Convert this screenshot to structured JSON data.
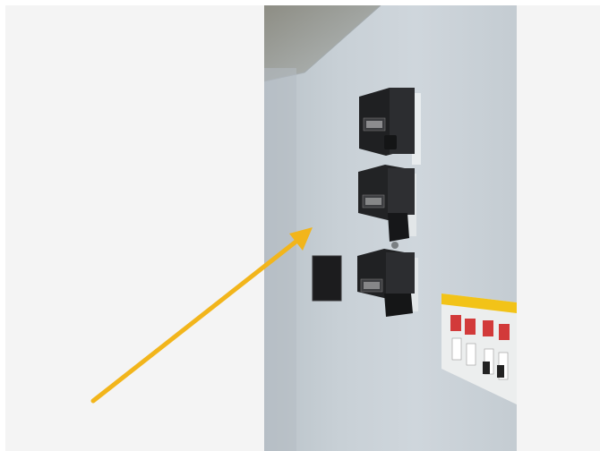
{
  "image": {
    "subject": "electrical-meters-on-wall",
    "colors": {
      "background": "#f4f4f4",
      "wall": "#cbd3d9",
      "meter_body": "#1e1f21",
      "breaker_panel": "#f2c318",
      "arrow": "#f2b51b"
    }
  }
}
